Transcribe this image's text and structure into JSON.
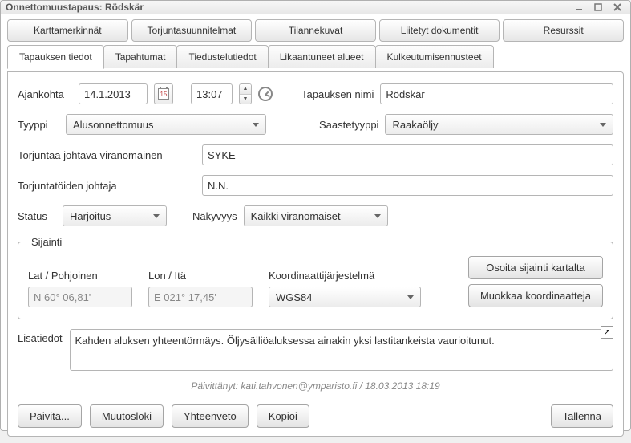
{
  "window": {
    "title": "Onnettomuustapaus: Rödskär"
  },
  "tabs_top": [
    {
      "label": "Karttamerkinnät"
    },
    {
      "label": "Torjuntasuunnitelmat"
    },
    {
      "label": "Tilannekuvat"
    },
    {
      "label": "Liitetyt dokumentit"
    },
    {
      "label": "Resurssit"
    }
  ],
  "tabs_second": [
    {
      "label": "Tapauksen tiedot"
    },
    {
      "label": "Tapahtumat"
    },
    {
      "label": "Tiedustelutiedot"
    },
    {
      "label": "Likaantuneet alueet"
    },
    {
      "label": "Kulkeutumisennusteet"
    }
  ],
  "form": {
    "ajankohta_label": "Ajankohta",
    "date": "14.1.2013",
    "cal_day": "15",
    "time": "13:07",
    "tapauksen_nimi_label": "Tapauksen nimi",
    "tapauksen_nimi": "Rödskär",
    "tyyppi_label": "Tyyppi",
    "tyyppi": "Alusonnettomuus",
    "saastetyyppi_label": "Saastetyyppi",
    "saastetyyppi": "Raakaöljy",
    "viranomainen_label": "Torjuntaa johtava viranomainen",
    "viranomainen": "SYKE",
    "johtaja_label": "Torjuntatöiden johtaja",
    "johtaja": "N.N.",
    "status_label": "Status",
    "status": "Harjoitus",
    "nakyvyys_label": "Näkyvyys",
    "nakyvyys": "Kaikki viranomaiset"
  },
  "sijainti": {
    "legend": "Sijainti",
    "lat_label": "Lat / Pohjoinen",
    "lat": "N 60° 06,81'",
    "lon_label": "Lon / Itä",
    "lon": "E 021° 17,45'",
    "coord_label": "Koordinaattijärjestelmä",
    "coord": "WGS84",
    "btn_show": "Osoita sijainti kartalta",
    "btn_edit": "Muokkaa koordinaatteja"
  },
  "lisatiedot": {
    "label": "Lisätiedot",
    "text": "Kahden aluksen yhteentörmäys. Öljysäiliöaluksessa ainakin yksi lastitankeista vaurioitunut."
  },
  "updated": "Päivittänyt: kati.tahvonen@ymparisto.fi / 18.03.2013 18:19",
  "footer": {
    "paivita": "Päivitä...",
    "muutosloki": "Muutosloki",
    "yhteenveto": "Yhteenveto",
    "kopioi": "Kopioi",
    "tallenna": "Tallenna"
  }
}
